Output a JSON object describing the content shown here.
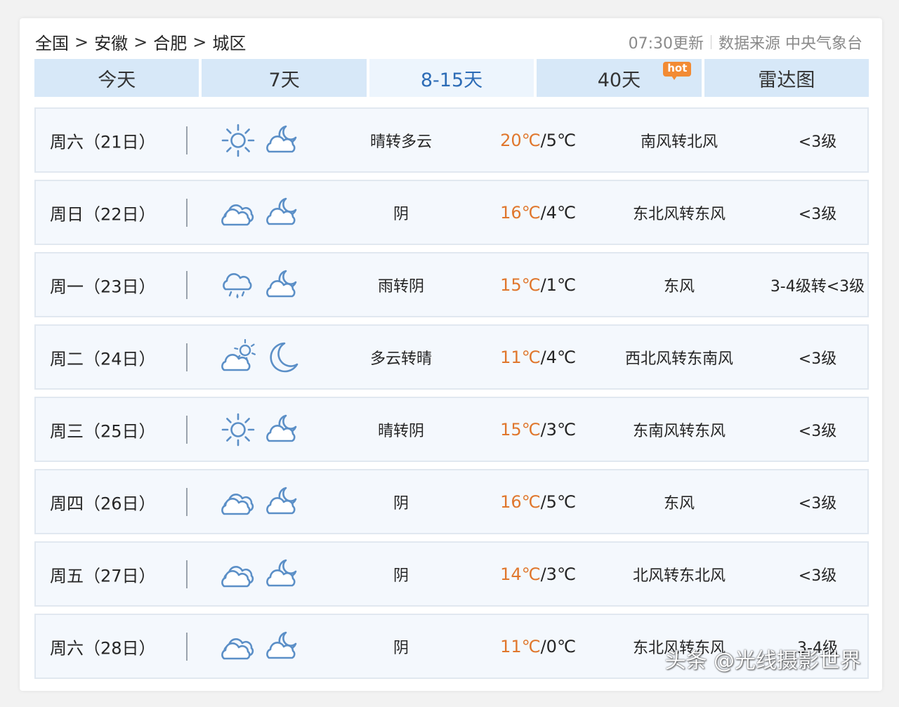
{
  "breadcrumb": [
    "全国",
    "安徽",
    "合肥",
    "城区"
  ],
  "breadcrumb_sep": ">",
  "update": {
    "time_label": "07:30更新",
    "source_label": "数据来源 中央气象台"
  },
  "tabs": [
    {
      "label": "今天"
    },
    {
      "label": "7天"
    },
    {
      "label": "8-15天",
      "active": true
    },
    {
      "label": "40天",
      "badge": "hot"
    },
    {
      "label": "雷达图"
    }
  ],
  "colors": {
    "high_temp": "#e0772d",
    "active_tab": "#2d6cb6",
    "tab_bg": "#d7e8f8",
    "icon_stroke": "#5b8fc7"
  },
  "days": [
    {
      "date": "周六（21日）",
      "icon_day": "sun-icon",
      "icon_night": "cloudy-night-icon",
      "desc": "晴转多云",
      "hi": "20℃",
      "lo": "/5℃",
      "wind": "南风转北风",
      "level": "<3级"
    },
    {
      "date": "周日（22日）",
      "icon_day": "overcast-icon",
      "icon_night": "cloudy-night-icon",
      "desc": "阴",
      "hi": "16℃",
      "lo": "/4℃",
      "wind": "东北风转东风",
      "level": "<3级"
    },
    {
      "date": "周一（23日）",
      "icon_day": "rain-icon",
      "icon_night": "cloudy-night-icon",
      "desc": "雨转阴",
      "hi": "15℃",
      "lo": "/1℃",
      "wind": "东风",
      "level": "3-4级转<3级"
    },
    {
      "date": "周二（24日）",
      "icon_day": "partly-cloudy-icon",
      "icon_night": "moon-icon",
      "desc": "多云转晴",
      "hi": "11℃",
      "lo": "/4℃",
      "wind": "西北风转东南风",
      "level": "<3级"
    },
    {
      "date": "周三（25日）",
      "icon_day": "sun-icon",
      "icon_night": "cloudy-night-icon",
      "desc": "晴转阴",
      "hi": "15℃",
      "lo": "/3℃",
      "wind": "东南风转东风",
      "level": "<3级"
    },
    {
      "date": "周四（26日）",
      "icon_day": "overcast-icon",
      "icon_night": "cloudy-night-icon",
      "desc": "阴",
      "hi": "16℃",
      "lo": "/5℃",
      "wind": "东风",
      "level": "<3级"
    },
    {
      "date": "周五（27日）",
      "icon_day": "overcast-icon",
      "icon_night": "cloudy-night-icon",
      "desc": "阴",
      "hi": "14℃",
      "lo": "/3℃",
      "wind": "北风转东北风",
      "level": "<3级"
    },
    {
      "date": "周六（28日）",
      "icon_day": "overcast-icon",
      "icon_night": "cloudy-night-icon",
      "desc": "阴",
      "hi": "11℃",
      "lo": "/0℃",
      "wind": "东北风转东风",
      "level": "3-4级"
    }
  ],
  "watermark": "头条 @光线摄影世界"
}
